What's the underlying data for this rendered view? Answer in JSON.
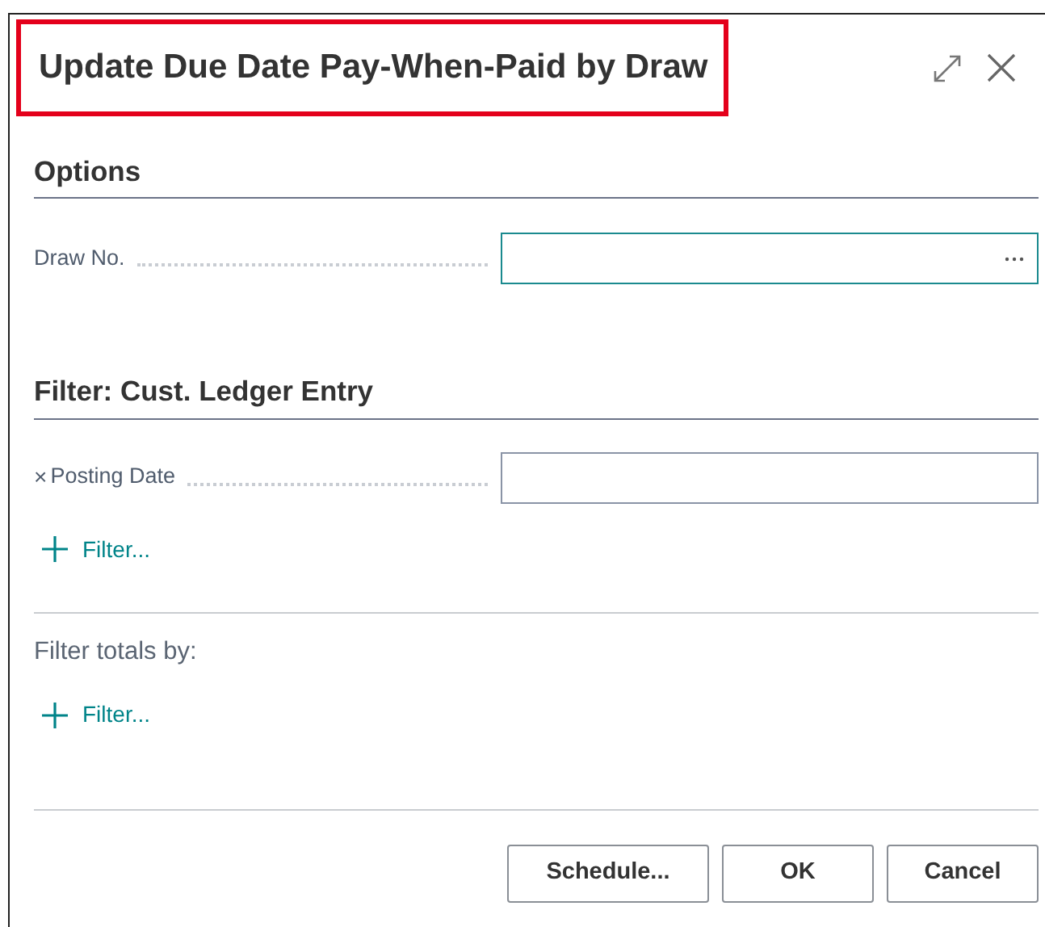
{
  "dialog": {
    "title": "Update Due Date Pay-When-Paid by Draw",
    "title_highlighted": true
  },
  "options": {
    "heading": "Options",
    "fields": [
      {
        "kind": "lookup",
        "label": "Draw No.",
        "focused": true
      }
    ]
  },
  "filter": {
    "heading": "Filter: Cust. Ledger Entry",
    "fields": [
      {
        "kind": "filter",
        "remove": "×",
        "label": "Posting Date",
        "focused": false
      }
    ],
    "add_filter": "Filter..."
  },
  "totals": {
    "label": "Filter totals by:",
    "add_filter": "Filter..."
  },
  "buttons": [
    "Schedule...",
    "OK",
    "Cancel"
  ]
}
